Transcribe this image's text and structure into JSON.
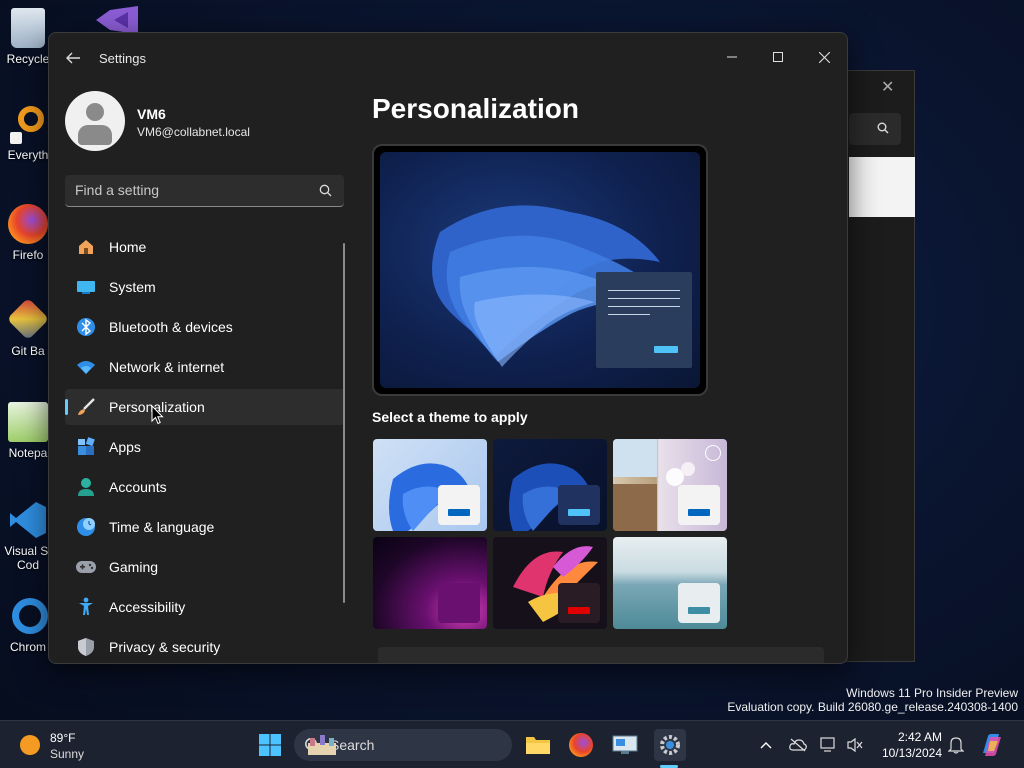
{
  "desktop": {
    "icons": [
      {
        "label": "Recycle"
      },
      {
        "label": "Everyth"
      },
      {
        "label": "Firefo"
      },
      {
        "label": "Git Ba"
      },
      {
        "label": "Notepa"
      },
      {
        "label": "Visual St",
        "label2": "Cod"
      },
      {
        "label": "Chrom"
      }
    ]
  },
  "window": {
    "title": "Settings",
    "minimize_icon": "minimize-icon",
    "maximize_icon": "maximize-icon",
    "close_icon": "close-icon"
  },
  "profile": {
    "name": "VM6",
    "email": "VM6@collabnet.local"
  },
  "search": {
    "placeholder": "Find a setting"
  },
  "nav": {
    "items": [
      {
        "label": "Home",
        "icon": "home-icon"
      },
      {
        "label": "System",
        "icon": "monitor-icon"
      },
      {
        "label": "Bluetooth & devices",
        "icon": "bluetooth-icon"
      },
      {
        "label": "Network & internet",
        "icon": "wifi-icon"
      },
      {
        "label": "Personalization",
        "icon": "paintbrush-icon",
        "selected": true
      },
      {
        "label": "Apps",
        "icon": "apps-icon"
      },
      {
        "label": "Accounts",
        "icon": "person-icon"
      },
      {
        "label": "Time & language",
        "icon": "globe-clock-icon"
      },
      {
        "label": "Gaming",
        "icon": "gamepad-icon"
      },
      {
        "label": "Accessibility",
        "icon": "accessibility-icon"
      },
      {
        "label": "Privacy & security",
        "icon": "shield-icon"
      }
    ]
  },
  "main": {
    "title": "Personalization",
    "themes_label": "Select a theme to apply",
    "themes": [
      {
        "name": "windows-light",
        "chip_bg": "#f3f3f3",
        "chip_bar": "#0067c0"
      },
      {
        "name": "windows-dark",
        "chip_bg": "#1f3260",
        "chip_bar": "#4fc3f7"
      },
      {
        "name": "windows-spotlight",
        "chip_bg": "#f3f3f3",
        "chip_bar": "#0067c0"
      },
      {
        "name": "glow",
        "chip_bg": "#6a1070",
        "chip_bar": "#6a1070"
      },
      {
        "name": "captured-motion",
        "chip_bg": "#2a1c24",
        "chip_bar": "#e00000"
      },
      {
        "name": "flow",
        "chip_bg": "#e8eef0",
        "chip_bar": "#3d8ea5"
      }
    ]
  },
  "watermark": {
    "line1": "Windows 11 Pro Insider Preview",
    "line2": "Evaluation copy. Build 26080.ge_release.240308-1400"
  },
  "taskbar": {
    "weather_temp": "89°F",
    "weather_condition": "Sunny",
    "search_label": "Search",
    "time": "2:42 AM",
    "date": "10/13/2024",
    "accent": "#60cdff"
  }
}
